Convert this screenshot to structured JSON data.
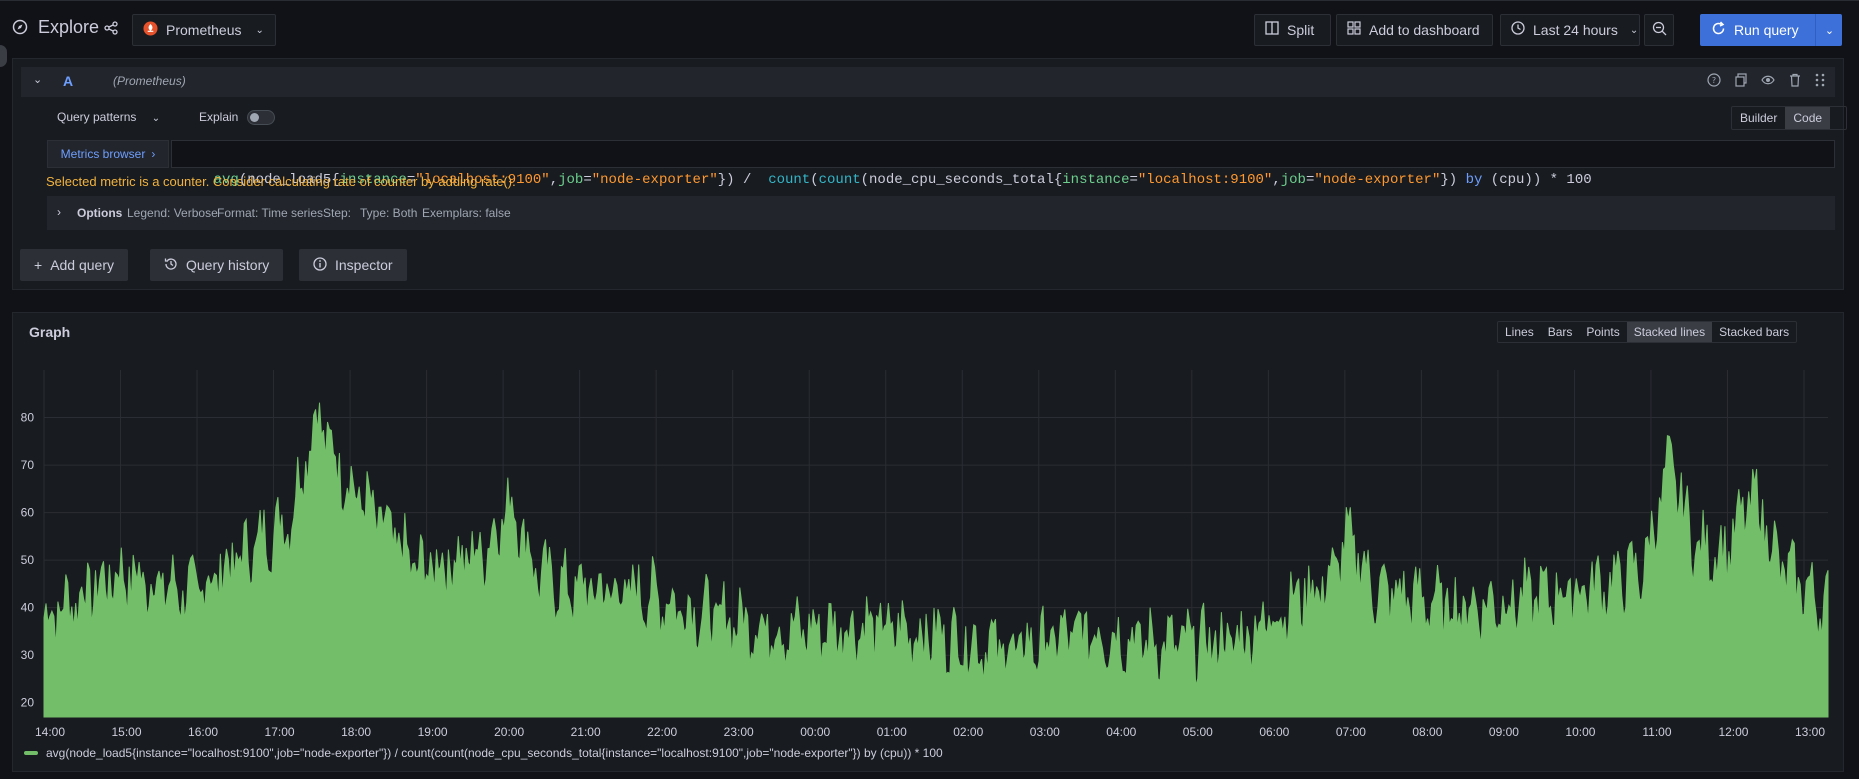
{
  "header": {
    "title": "Explore",
    "datasource": "Prometheus",
    "split": "Split",
    "add_to_dashboard": "Add to dashboard",
    "time_range": "Last 24 hours",
    "run_query": "Run query"
  },
  "query": {
    "letter": "A",
    "datasource_hint": "(Prometheus)",
    "patterns": "Query patterns",
    "explain": "Explain",
    "builder": "Builder",
    "code": "Code",
    "metrics_browser": "Metrics browser",
    "expression_parts": [
      "avg",
      "(node_load5{",
      "instance",
      "=",
      "\"localhost:9100\"",
      ",",
      "job",
      "=",
      "\"node-exporter\"",
      "}) /  ",
      "count",
      "(",
      "count",
      "(node_cpu_seconds_total{",
      "instance",
      "=",
      "\"localhost:9100\"",
      ",",
      "job",
      "=",
      "\"node-exporter\"",
      "}) ",
      "by",
      " (cpu)) * 100"
    ],
    "warning": "Selected metric is a counter. Consider calculating rate of counter by adding rate().",
    "options": {
      "label": "Options",
      "legend": "Legend: Verbose",
      "format": "Format: Time series",
      "step": "Step:",
      "type": "Type: Both",
      "exemplars": "Exemplars: false"
    }
  },
  "actions": {
    "add_query": "Add query",
    "query_history": "Query history",
    "inspector": "Inspector"
  },
  "graph": {
    "title": "Graph",
    "modes": [
      "Lines",
      "Bars",
      "Points",
      "Stacked lines",
      "Stacked bars"
    ],
    "active_mode": "Stacked lines",
    "legend": "avg(node_load5{instance=\"localhost:9100\",job=\"node-exporter\"}) / count(count(node_cpu_seconds_total{instance=\"localhost:9100\",job=\"node-exporter\"}) by (cpu)) * 100",
    "series_color": "#73bf69"
  },
  "chart_data": {
    "type": "area",
    "x": [
      "14:00",
      "15:00",
      "16:00",
      "17:00",
      "18:00",
      "19:00",
      "20:00",
      "21:00",
      "22:00",
      "23:00",
      "00:00",
      "01:00",
      "02:00",
      "03:00",
      "04:00",
      "05:00",
      "06:00",
      "07:00",
      "08:00",
      "09:00",
      "10:00",
      "11:00",
      "12:00",
      "13:00",
      "13:55"
    ],
    "values": [
      38,
      47,
      43,
      55,
      68,
      48,
      52,
      44,
      43,
      38,
      35,
      36,
      34,
      31,
      35,
      32,
      33,
      44,
      43,
      40,
      42,
      45,
      52,
      52,
      40
    ],
    "peaks": [
      {
        "x": "17:40",
        "y": 82
      },
      {
        "x": "11:48",
        "y": 71
      },
      {
        "x": "12:55",
        "y": 64
      },
      {
        "x": "20:15",
        "y": 63
      },
      {
        "x": "07:30",
        "y": 55
      }
    ],
    "yticks": [
      20,
      30,
      40,
      50,
      60,
      70,
      80
    ],
    "ylim": [
      17,
      90
    ],
    "series": [
      {
        "name": "avg(node_load5{instance=\"localhost:9100\",job=\"node-exporter\"}) / count(count(node_cpu_seconds_total{instance=\"localhost:9100\",job=\"node-exporter\"}) by (cpu)) * 100"
      }
    ]
  }
}
